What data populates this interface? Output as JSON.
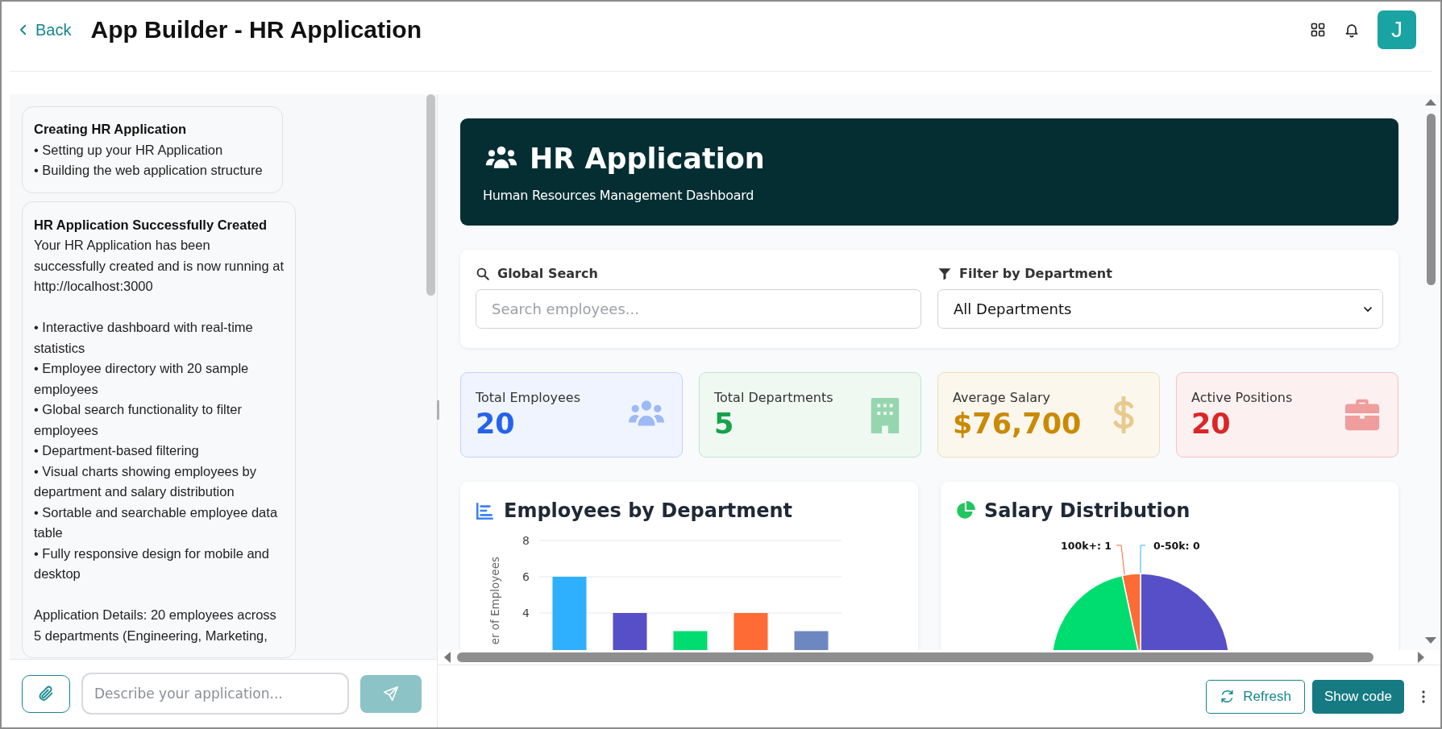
{
  "header": {
    "back_label": "Back",
    "title": "App Builder - HR Application",
    "avatar_initial": "J"
  },
  "chat": {
    "messages": [
      {
        "title": "Creating HR Application",
        "paragraphs": [
          [
            "• Setting up your HR Application",
            "• Building the web application structure"
          ]
        ]
      },
      {
        "title": "HR Application Successfully Created",
        "paragraphs": [
          [
            "Your HR Application has been successfully created and is now running at http://localhost:3000"
          ],
          [
            "• Interactive dashboard with real-time statistics",
            "• Employee directory with 20 sample employees",
            "• Global search functionality to filter employees",
            "• Department-based filtering",
            "• Visual charts showing employees by department and salary distribution",
            "• Sortable and searchable employee data table",
            "• Fully responsive design for mobile and desktop"
          ],
          [
            "Application Details: 20 employees across 5 departments (Engineering, Marketing,"
          ]
        ]
      }
    ],
    "input": {
      "placeholder": "Describe your application..."
    }
  },
  "preview": {
    "banner": {
      "title": "HR Application",
      "subtitle": "Human Resources Management Dashboard"
    },
    "search": {
      "label": "Global Search",
      "placeholder": "Search employees..."
    },
    "filter": {
      "label": "Filter by Department",
      "value": "All Departments"
    },
    "stats": [
      {
        "label": "Total Employees",
        "value": "20",
        "kind": "people",
        "color": "#2563eb"
      },
      {
        "label": "Total Departments",
        "value": "5",
        "kind": "building",
        "color": "#16a34a"
      },
      {
        "label": "Average Salary",
        "value": "$76,700",
        "kind": "dollar",
        "color": "#ca8a04"
      },
      {
        "label": "Active Positions",
        "value": "20",
        "kind": "briefcase",
        "color": "#dc2626"
      }
    ],
    "bar_panel": {
      "title": "Employees by Department",
      "chart_data": {
        "type": "bar",
        "ylabel": "er of Employees",
        "ylim": [
          0,
          8
        ],
        "grid": true,
        "yticks": [
          4,
          6,
          8
        ],
        "values": [
          6,
          4,
          3,
          4,
          3
        ],
        "colors": [
          "#2eb0ff",
          "#574fc7",
          "#00dd70",
          "#ff6b35",
          "#6d87c0"
        ]
      }
    },
    "pie_panel": {
      "title": "Salary Distribution",
      "labels": [
        "100k+: 1",
        "0-50k: 0"
      ]
    }
  },
  "footer": {
    "refresh": "Refresh",
    "show_code": "Show code"
  }
}
